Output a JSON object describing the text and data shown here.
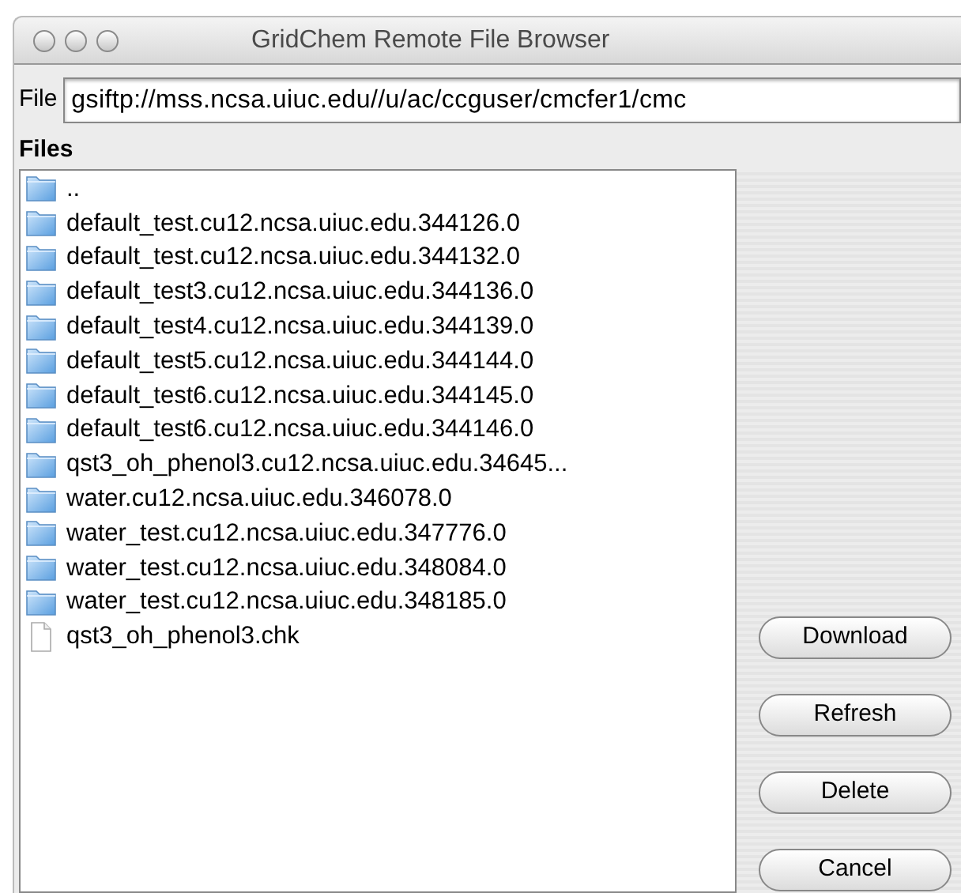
{
  "window": {
    "title": "GridChem Remote File Browser"
  },
  "file_field": {
    "label": "File",
    "value": "gsiftp://mss.ncsa.uiuc.edu//u/ac/ccguser/cmcfer1/cmc"
  },
  "files_label": "Files",
  "files": [
    {
      "name": "..",
      "kind": "folder"
    },
    {
      "name": "default_test.cu12.ncsa.uiuc.edu.344126.0",
      "kind": "folder"
    },
    {
      "name": "default_test.cu12.ncsa.uiuc.edu.344132.0",
      "kind": "folder"
    },
    {
      "name": "default_test3.cu12.ncsa.uiuc.edu.344136.0",
      "kind": "folder"
    },
    {
      "name": "default_test4.cu12.ncsa.uiuc.edu.344139.0",
      "kind": "folder"
    },
    {
      "name": "default_test5.cu12.ncsa.uiuc.edu.344144.0",
      "kind": "folder"
    },
    {
      "name": "default_test6.cu12.ncsa.uiuc.edu.344145.0",
      "kind": "folder"
    },
    {
      "name": "default_test6.cu12.ncsa.uiuc.edu.344146.0",
      "kind": "folder"
    },
    {
      "name": "qst3_oh_phenol3.cu12.ncsa.uiuc.edu.34645...",
      "kind": "folder"
    },
    {
      "name": "water.cu12.ncsa.uiuc.edu.346078.0",
      "kind": "folder"
    },
    {
      "name": "water_test.cu12.ncsa.uiuc.edu.347776.0",
      "kind": "folder"
    },
    {
      "name": "water_test.cu12.ncsa.uiuc.edu.348084.0",
      "kind": "folder"
    },
    {
      "name": "water_test.cu12.ncsa.uiuc.edu.348185.0",
      "kind": "folder"
    },
    {
      "name": "qst3_oh_phenol3.chk",
      "kind": "file"
    }
  ],
  "buttons": [
    "Download",
    "Refresh",
    "Delete",
    "Cancel"
  ]
}
